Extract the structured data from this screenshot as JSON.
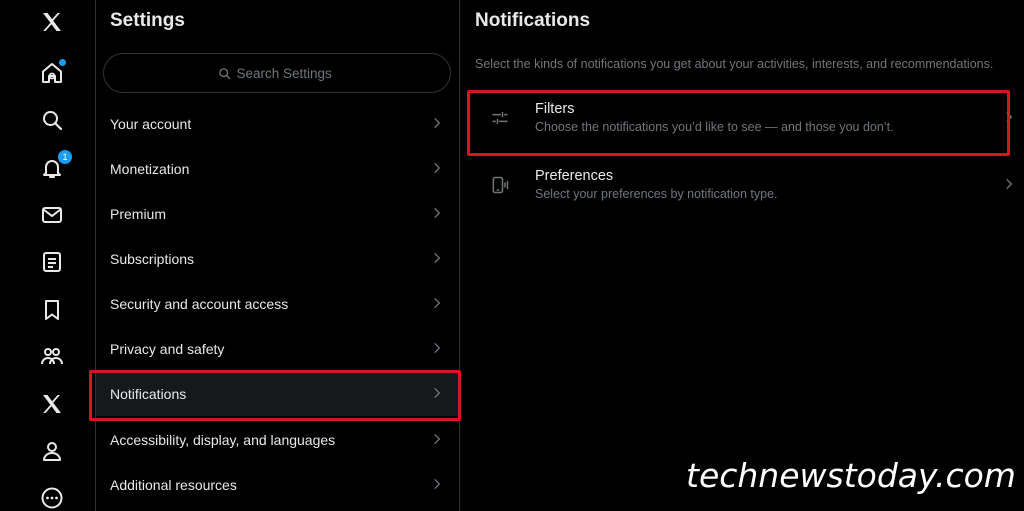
{
  "nav": {
    "items": [
      {
        "name": "x-logo-icon"
      },
      {
        "name": "home-icon",
        "badge": "dot"
      },
      {
        "name": "search-icon"
      },
      {
        "name": "bell-icon",
        "badge": "1"
      },
      {
        "name": "mail-icon"
      },
      {
        "name": "list-icon"
      },
      {
        "name": "bookmark-icon"
      },
      {
        "name": "communities-icon"
      },
      {
        "name": "x-premium-icon"
      },
      {
        "name": "profile-icon"
      },
      {
        "name": "more-icon"
      }
    ],
    "notification_count": "1"
  },
  "settings": {
    "title": "Settings",
    "search_placeholder": "Search Settings",
    "items": [
      {
        "label": "Your account"
      },
      {
        "label": "Monetization"
      },
      {
        "label": "Premium"
      },
      {
        "label": "Subscriptions"
      },
      {
        "label": "Security and account access"
      },
      {
        "label": "Privacy and safety"
      },
      {
        "label": "Notifications",
        "active": true
      },
      {
        "label": "Accessibility, display, and languages"
      },
      {
        "label": "Additional resources"
      }
    ]
  },
  "notifications": {
    "title": "Notifications",
    "description": "Select the kinds of notifications you get about your activities, interests, and recommendations.",
    "options": [
      {
        "label": "Filters",
        "sub": "Choose the notifications you’d like to see — and those you don’t.",
        "icon": "sliders-icon"
      },
      {
        "label": "Preferences",
        "sub": "Select your preferences by notification type.",
        "icon": "device-icon"
      }
    ]
  },
  "watermark": "technewstoday.com",
  "colors": {
    "accent": "#1d9bf0",
    "highlight": "#d9151f",
    "muted": "#71767b",
    "text": "#e7e9ea"
  }
}
